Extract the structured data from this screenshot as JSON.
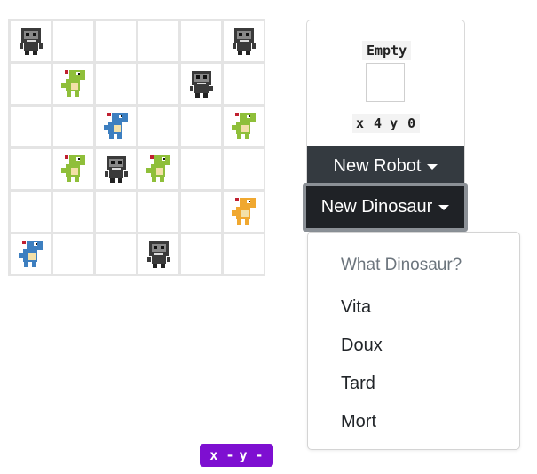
{
  "board": {
    "rows": 6,
    "cols": 6,
    "pieces": [
      {
        "row": 0,
        "col": 0,
        "kind": "robot"
      },
      {
        "row": 0,
        "col": 5,
        "kind": "robot"
      },
      {
        "row": 1,
        "col": 1,
        "kind": "dino",
        "color": "#8fbf3a"
      },
      {
        "row": 1,
        "col": 4,
        "kind": "robot"
      },
      {
        "row": 2,
        "col": 2,
        "kind": "dino",
        "color": "#3d7fc0"
      },
      {
        "row": 2,
        "col": 5,
        "kind": "dino",
        "color": "#8fbf3a"
      },
      {
        "row": 3,
        "col": 1,
        "kind": "dino",
        "color": "#8fbf3a"
      },
      {
        "row": 3,
        "col": 2,
        "kind": "robot"
      },
      {
        "row": 3,
        "col": 3,
        "kind": "dino",
        "color": "#8fbf3a"
      },
      {
        "row": 4,
        "col": 5,
        "kind": "dino",
        "color": "#f0a830"
      },
      {
        "row": 5,
        "col": 0,
        "kind": "dino",
        "color": "#3d7fc0"
      },
      {
        "row": 5,
        "col": 3,
        "kind": "robot"
      }
    ]
  },
  "panel": {
    "selected_label": "Empty",
    "x_label": "x 4",
    "y_label": "y 0",
    "new_robot_label": "New Robot",
    "new_dinosaur_label": "New Dinosaur"
  },
  "dropdown": {
    "header": "What Dinosaur?",
    "items": [
      "Vita",
      "Doux",
      "Tard",
      "Mort"
    ]
  },
  "status_badge": {
    "x_text": "x -",
    "y_text": "y -"
  },
  "colors": {
    "robot_body": "#3a3a3a",
    "badge": "#7e0fd1",
    "button_dark": "#343a40"
  }
}
